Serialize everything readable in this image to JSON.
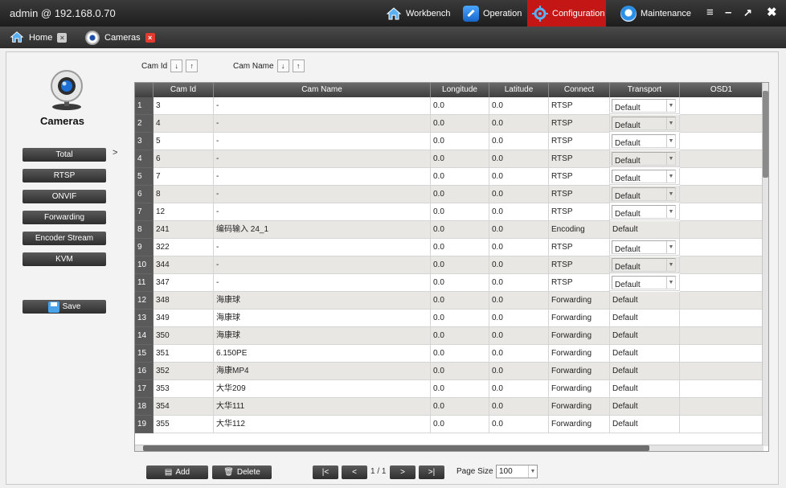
{
  "titlebar": {
    "title": "admin @ 192.168.0.70",
    "nav": [
      {
        "label": "Workbench",
        "icon": "house-icon",
        "active": false
      },
      {
        "label": "Operation",
        "icon": "wrench-icon",
        "active": false
      },
      {
        "label": "Configuration",
        "icon": "gear-icon",
        "active": true
      },
      {
        "label": "Maintenance",
        "icon": "globe-icon",
        "active": false
      }
    ]
  },
  "tabs": [
    {
      "label": "Home"
    },
    {
      "label": "Cameras"
    }
  ],
  "sidebar": {
    "title": "Cameras",
    "items": [
      {
        "label": "Total",
        "selected": true
      },
      {
        "label": "RTSP"
      },
      {
        "label": "ONVIF"
      },
      {
        "label": "Forwarding"
      },
      {
        "label": "Encoder Stream"
      },
      {
        "label": "KVM"
      }
    ],
    "arrow": ">",
    "save_label": "Save"
  },
  "sortbar": {
    "camid_label": "Cam Id",
    "camname_label": "Cam Name"
  },
  "grid": {
    "columns": [
      "Cam Id",
      "Cam Name",
      "Longitude",
      "Latitude",
      "Connect",
      "Transport",
      "OSD1"
    ],
    "rows": [
      [
        "1",
        "3",
        "-",
        "0.0",
        "0.0",
        "RTSP",
        "Default"
      ],
      [
        "2",
        "4",
        "-",
        "0.0",
        "0.0",
        "RTSP",
        "Default"
      ],
      [
        "3",
        "5",
        "-",
        "0.0",
        "0.0",
        "RTSP",
        "Default"
      ],
      [
        "4",
        "6",
        "-",
        "0.0",
        "0.0",
        "RTSP",
        "Default"
      ],
      [
        "5",
        "7",
        "-",
        "0.0",
        "0.0",
        "RTSP",
        "Default"
      ],
      [
        "6",
        "8",
        "-",
        "0.0",
        "0.0",
        "RTSP",
        "Default"
      ],
      [
        "7",
        "12",
        "-",
        "0.0",
        "0.0",
        "RTSP",
        "Default"
      ],
      [
        "8",
        "241",
        "编码输入 24_1",
        "0.0",
        "0.0",
        "Encoding",
        "Default"
      ],
      [
        "9",
        "322",
        "-",
        "0.0",
        "0.0",
        "RTSP",
        "Default"
      ],
      [
        "10",
        "344",
        "-",
        "0.0",
        "0.0",
        "RTSP",
        "Default"
      ],
      [
        "11",
        "347",
        "-",
        "0.0",
        "0.0",
        "RTSP",
        "Default"
      ],
      [
        "12",
        "348",
        "海康球",
        "0.0",
        "0.0",
        "Forwarding",
        "Default"
      ],
      [
        "13",
        "349",
        "海康球",
        "0.0",
        "0.0",
        "Forwarding",
        "Default"
      ],
      [
        "14",
        "350",
        "海康球",
        "0.0",
        "0.0",
        "Forwarding",
        "Default"
      ],
      [
        "15",
        "351",
        "6.150PE",
        "0.0",
        "0.0",
        "Forwarding",
        "Default"
      ],
      [
        "16",
        "352",
        "海康MP4",
        "0.0",
        "0.0",
        "Forwarding",
        "Default"
      ],
      [
        "17",
        "353",
        "大华209",
        "0.0",
        "0.0",
        "Forwarding",
        "Default"
      ],
      [
        "18",
        "354",
        "大华111",
        "0.0",
        "0.0",
        "Forwarding",
        "Default"
      ],
      [
        "19",
        "355",
        "大华112",
        "0.0",
        "0.0",
        "Forwarding",
        "Default"
      ]
    ]
  },
  "toolbar": {
    "add_label": "Add",
    "delete_label": "Delete",
    "first_label": "|<",
    "prev_label": "<",
    "page_info": "1 / 1",
    "next_label": ">",
    "last_label": ">|",
    "page_size_label": "Page Size",
    "page_size_value": "100"
  },
  "colors": {
    "active_nav": "#c51616",
    "header_dark": "#2c2c2c",
    "row_alt": "#e9e7e3"
  }
}
